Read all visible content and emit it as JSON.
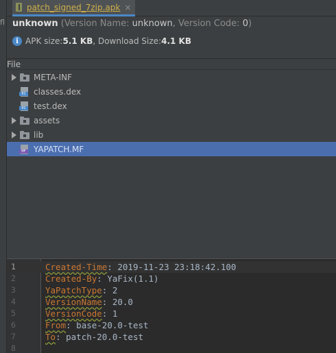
{
  "left_strip": {
    "fragment": "fl"
  },
  "tab": {
    "label": "patch_signed_7zip.apk",
    "close": "×"
  },
  "info": {
    "package": "unknown",
    "meta_prefix": " (Version Name: ",
    "version_name": "unknown",
    "meta_mid": ", Version Code: ",
    "version_code": "0",
    "meta_suffix": ")",
    "apk_size_label": "APK size: ",
    "apk_size": "5.1 KB",
    "download_size_label": ", Download Size: ",
    "download_size": "4.1 KB"
  },
  "tree": {
    "header": "File",
    "items": [
      {
        "label": "META-INF",
        "type": "folder"
      },
      {
        "label": "classes.dex",
        "type": "file",
        "tag": "01"
      },
      {
        "label": "test.dex",
        "type": "file",
        "tag": "01"
      },
      {
        "label": "assets",
        "type": "folder"
      },
      {
        "label": "lib",
        "type": "folder"
      },
      {
        "label": "YAPATCH.MF",
        "type": "file",
        "tag": "MF",
        "selected": true
      }
    ]
  },
  "editor": {
    "current_line": 1,
    "lines": [
      {
        "n": "1",
        "key": "Created-Time",
        "value": " 2019-11-23 23:18:42.100",
        "warn": true
      },
      {
        "n": "2",
        "key": "Created-By",
        "value": " YaFix(1.1)",
        "warn": false
      },
      {
        "n": "3",
        "key": "YaPatchType",
        "value": " 2",
        "warn": true
      },
      {
        "n": "4",
        "key": "VersionName",
        "value": " 20.0",
        "warn": true
      },
      {
        "n": "5",
        "key": "VersionCode",
        "value": " 1",
        "warn": true
      },
      {
        "n": "6",
        "key": "From",
        "value": " base-20.0-test",
        "warn": true
      },
      {
        "n": "7",
        "key": "To",
        "value": " patch-20.0-test",
        "warn": true
      },
      {
        "n": "8",
        "key": "",
        "value": "",
        "warn": false
      }
    ]
  },
  "colors": {
    "accent": "#4a88c7",
    "selection": "#4b6eaf",
    "key": "#cc7832",
    "tab_label": "#d0b04a"
  }
}
